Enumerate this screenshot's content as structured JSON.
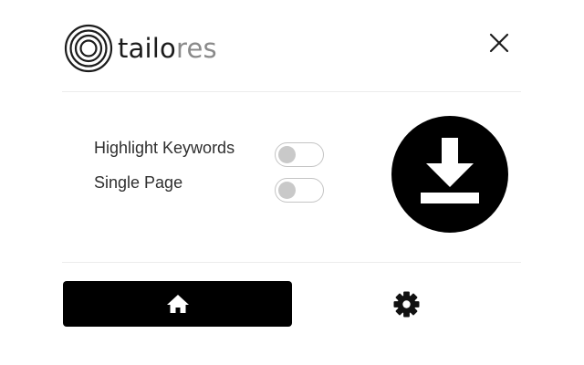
{
  "header": {
    "logo_text_dark": "tailo",
    "logo_text_light": "res",
    "close_icon": "close-icon"
  },
  "options": [
    {
      "label": "Highlight Keywords",
      "enabled": false
    },
    {
      "label": "Single Page",
      "enabled": false
    }
  ],
  "actions": {
    "download_icon": "download-icon"
  },
  "footer": {
    "home_icon": "home-icon",
    "settings_icon": "gear-icon"
  },
  "colors": {
    "primary": "#000000",
    "logo_dark": "#1c1c1c",
    "logo_light": "#8a8a8a",
    "toggle_off_knob": "#c9c9c9",
    "toggle_border": "#c4c4c4"
  }
}
